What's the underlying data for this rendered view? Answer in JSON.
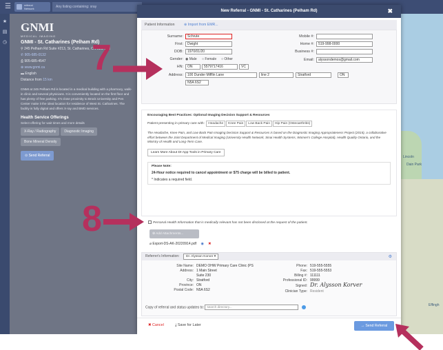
{
  "topbar": {
    "logo_line1": "referral",
    "logo_line2": "Network",
    "listing_placeholder": "Any listing containing: xray"
  },
  "rail": {
    "icons": [
      "star-icon",
      "list-icon",
      "clock-icon"
    ]
  },
  "clinic": {
    "brand": "GNMI",
    "brand_sub": "MEDICAL IMAGING",
    "name": "GNMI - St. Catharines (Pelham Rd)",
    "address": "245 Pelham Rd Suite #213, St. Catharines, ON L2S 1X8",
    "phone": "905-685-0132",
    "fax": "905-685-4547",
    "website": "www.gnmi.ca",
    "language": "English",
    "distance_label": "Distance from",
    "distance_value": "15 km",
    "description": "GNMI at 245 Pelham Rd is located in a medical building with a pharmacy, walk-in clinic and several physicians. It is conveniently located on the first floor and has plenty of free parking. It's close proximity to Brock University and Pen Center make it the ideal location for residence of West St. Catharines. The facility is fully digital and offers X-ray and BMD services.",
    "offerings_title": "Health Service Offerings",
    "offerings_sub": "Select offering for wait times and more details",
    "offerings": [
      "X-Ray / Radiography",
      "Diagnostic Imaging",
      "Bone Mineral Density"
    ],
    "send_button": "Send Referral"
  },
  "map": {
    "label_left": "Lincoln",
    "label_mid": "Dain Park",
    "label_bottom": "Effingh"
  },
  "modal": {
    "title": "New Referral - GNMI - St. Catharines (Pelham Rd)",
    "patient_section": "Patient Information",
    "import_emr": "Import from EMR...",
    "labels": {
      "surname": "Surname:",
      "first": "First:",
      "dob": "DOB:",
      "gender": "Gender:",
      "hn": "HN:",
      "address": "Address:",
      "mobile": "Mobile #:",
      "home": "Home #:",
      "business": "Business #:",
      "email": "Email:"
    },
    "values": {
      "surname": "Schrute",
      "first": "Dwight",
      "dob": "1970/01/20",
      "hn_prov": "ON",
      "hn_num": "5579717416",
      "hn_vc": "VC",
      "address1": "100 Dunder Mifflin Lane",
      "address2": "line 2",
      "city": "Stratford",
      "prov": "ON",
      "postal": "N5A 6S2",
      "mobile": "",
      "home": "519-998-0000",
      "business": "",
      "email": "alyssondemos@gmail.com"
    },
    "gender": {
      "male": "Male",
      "female": "Female",
      "other": "Other",
      "selected": "Male"
    },
    "best": {
      "title": "Encouraging Best Practices: Optional Imaging Decision Support & Resources",
      "presenting": "Patient presenting in primary care with:",
      "pills": [
        "Headache",
        "Knee Pain",
        "Low Back Pain",
        "Hip Pain (Osteoarthritis)"
      ],
      "desc": "The Headache, Knee Pain, and Low Back Pain Imaging Decision Support & Resources is based on the Diagnostic Imaging Appropriateness Project (2015), a collaborative effort between the Joint Department of Medical Imaging (University Health Network, Sinai Health Systems, Women's College Hospital), Health Quality Ontario, and the Ministry of Health and Long-Term Care.",
      "learn": "Learn More About DI-App Tools in Primary Care"
    },
    "note": {
      "title": "Please Note:",
      "line1": "24-Hour notice required to cancel appointment or $75 charge will be billed to patient.",
      "line2": "* Indicates a required field."
    },
    "phi": "Personal Health Information that is medically relevant has not been disclosed at the request of the patient.",
    "add_attachments": "Add Attachments...",
    "attachment": "Export-DS-AK-20220914.pdf",
    "referrer": {
      "label": "Referrer's Information:",
      "selected": "Dr. Alysson Korver",
      "site_name_label": "Site Name:",
      "site_name": "DEMO OHW Primary Care Clinic (PS",
      "address_label": "Address:",
      "address1": "1 Main Street",
      "address2": "Suite 230",
      "city_label": "City:",
      "city": "Stratford",
      "province_label": "Province:",
      "province": "ON",
      "postal_label": "Postal Code:",
      "postal": "N5A 6S2",
      "phone_label": "Phone:",
      "phone": "519-555-5555",
      "fax_label": "Fax:",
      "fax": "519-555-5553",
      "billing_label": "Billing #:",
      "billing": "111111",
      "prof_label": "Professional ID:",
      "prof": "99999",
      "signed_label": "Signed:",
      "signed": "Dr. Alysson Korver",
      "clin_label": "Clinician Type:",
      "clin": "Resident"
    },
    "copy_label": "Copy of referral and status updates to:",
    "copy_placeholder": "search directory...",
    "cancel": "Cancel",
    "save": "Save for Later",
    "send": "Send Referral"
  },
  "annotations": {
    "step7": "7",
    "step8": "8",
    "color": "#b5305d"
  }
}
